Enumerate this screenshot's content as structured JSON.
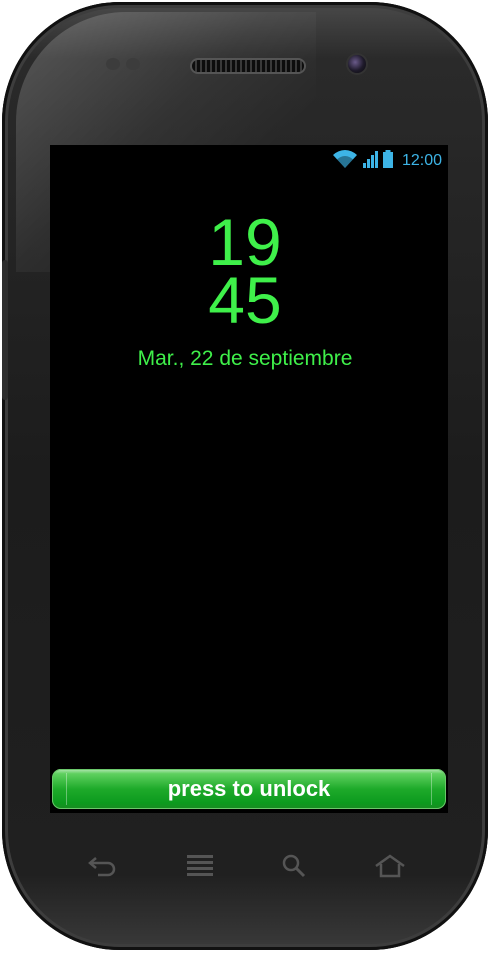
{
  "status_bar": {
    "time": "12:00",
    "icons": [
      "wifi-icon",
      "signal-icon",
      "battery-icon"
    ],
    "color": "#3db4e6"
  },
  "lock_screen": {
    "hours": "19",
    "minutes": "45",
    "date": "Mar., 22 de septiembre",
    "text_color": "#3ff04a"
  },
  "unlock_button": {
    "label": "press to unlock",
    "color": "#1eaa2a"
  },
  "hardware_keys": [
    "back-icon",
    "menu-icon",
    "search-icon",
    "home-icon"
  ]
}
